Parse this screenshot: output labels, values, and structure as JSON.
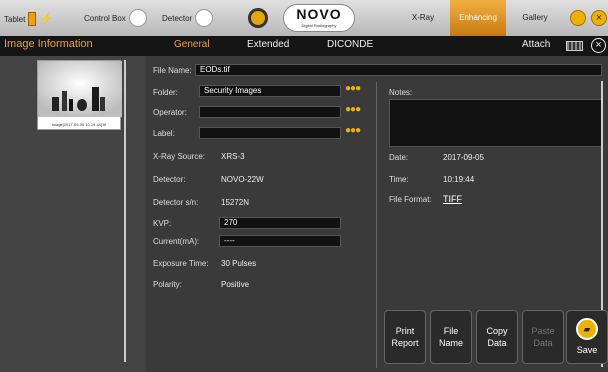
{
  "topbar": {
    "tablet_label": "Tablet",
    "control_box_label": "Control Box",
    "detector_label": "Detector",
    "logo_text": "NOVO",
    "logo_subtext": "Digital Radiography",
    "tabs": [
      {
        "label": "X-Ray",
        "active": false
      },
      {
        "label": "Enhancing",
        "active": true
      },
      {
        "label": "Gallery",
        "active": false
      }
    ]
  },
  "subbar": {
    "title": "Image Information",
    "tabs": [
      {
        "label": "General",
        "active": true
      },
      {
        "label": "Extended",
        "active": false
      },
      {
        "label": "DICONDE",
        "active": false
      }
    ],
    "attach_label": "Attach"
  },
  "thumbnail": {
    "caption": "image[2017-09-05 10.19.44].tif"
  },
  "form": {
    "file_name_label": "File Name:",
    "file_name_value": "EODs.tif",
    "folder_label": "Folder:",
    "folder_value": "Security Images",
    "operator_label": "Operator:",
    "operator_value": "",
    "label_label": "Label:",
    "label_value": "",
    "xray_source_label": "X-Ray Source:",
    "xray_source_value": "XRS-3",
    "detector_label": "Detector:",
    "detector_value": "NOVO-22W",
    "detector_sn_label": "Detector s/n:",
    "detector_sn_value": "15272N",
    "kvp_label": "KVP:",
    "kvp_value": "270",
    "current_label": "Current(mA):",
    "current_value": "----",
    "exposure_label": "Exposure Time:",
    "exposure_value": "30 Pulses",
    "polarity_label": "Polarity:",
    "polarity_value": "Positive"
  },
  "right": {
    "notes_label": "Notes:",
    "notes_value": "",
    "date_label": "Date:",
    "date_value": "2017-09-05",
    "time_label": "Time:",
    "time_value": "10:19:44",
    "format_label": "File Format:",
    "format_value": "TIFF"
  },
  "buttons": {
    "print_1": "Print",
    "print_2": "Report",
    "file_1": "File",
    "file_2": "Name",
    "copy_1": "Copy",
    "copy_2": "Data",
    "paste_1": "Paste",
    "paste_2": "Data",
    "save": "Save"
  },
  "colors": {
    "accent": "#f0a030",
    "background": "#3a3a3a"
  }
}
